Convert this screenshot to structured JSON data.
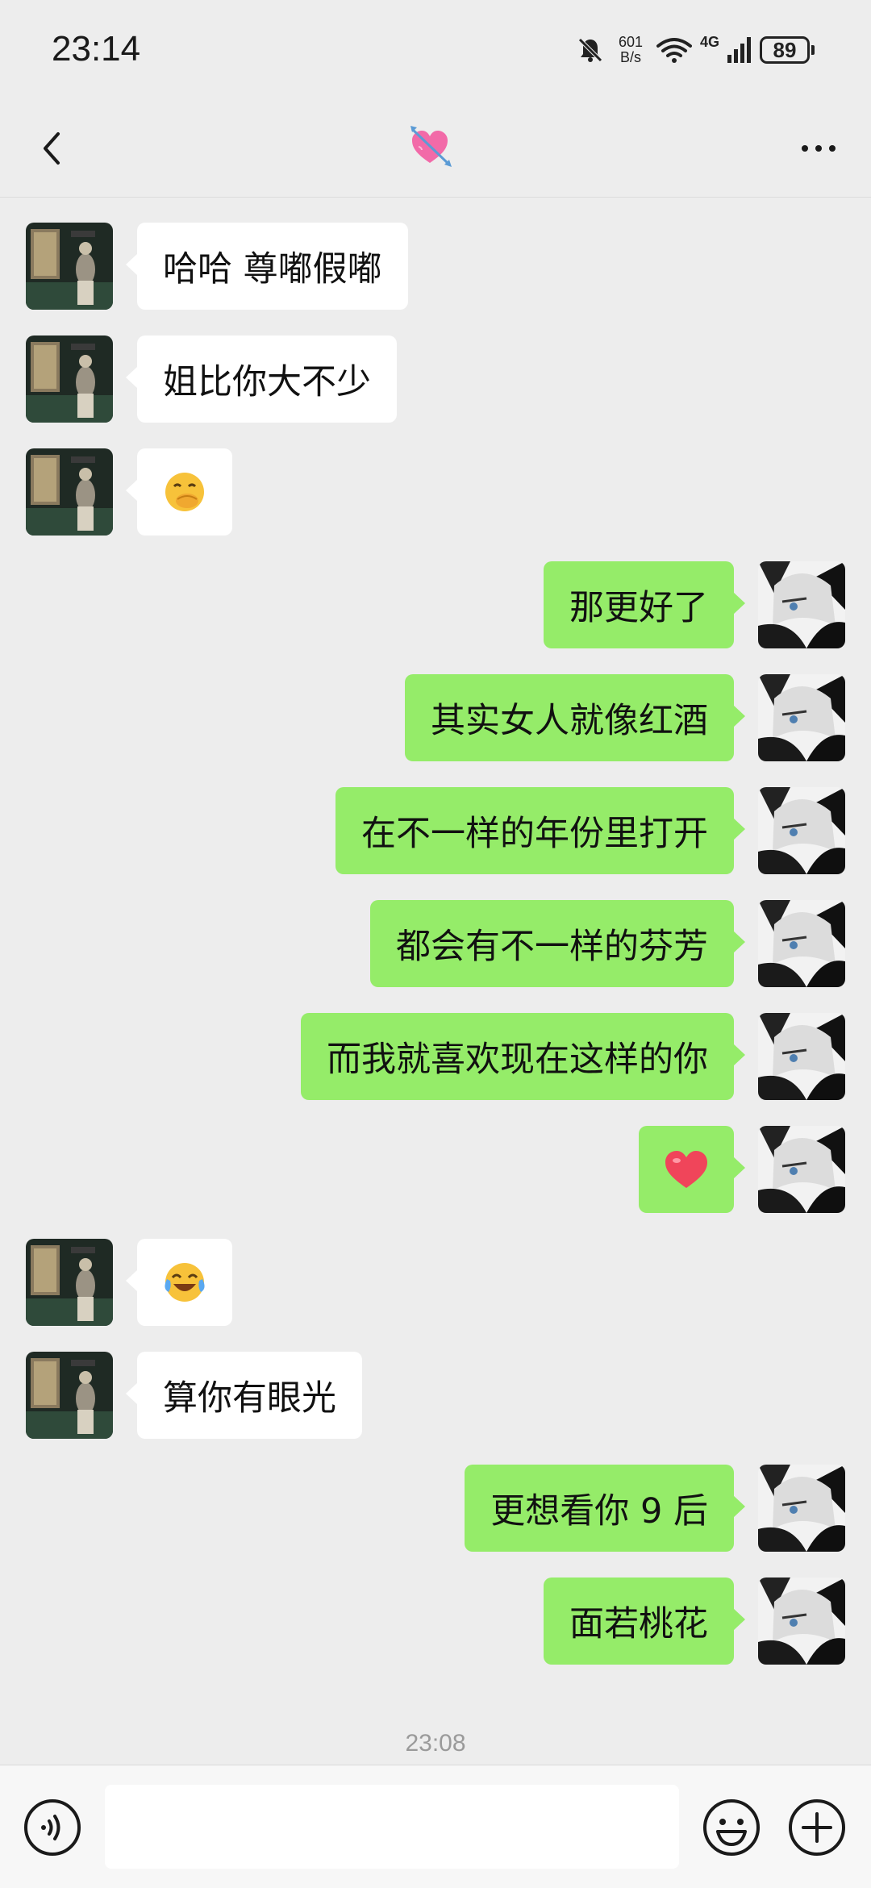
{
  "status": {
    "time": "23:14",
    "net_speed_value": "601",
    "net_speed_unit": "B/s",
    "network_type": "4G",
    "battery": "89"
  },
  "header": {
    "title_icon": "heart-with-arrow-icon",
    "back_icon": "chevron-left-icon",
    "more_icon": "more-dots-icon"
  },
  "messages": [
    {
      "side": "left",
      "text": "哈哈 尊嘟假嘟"
    },
    {
      "side": "left",
      "text": "姐比你大不少"
    },
    {
      "side": "left",
      "emoji": "🤭"
    },
    {
      "side": "right",
      "text": "那更好了"
    },
    {
      "side": "right",
      "text": "其实女人就像红酒"
    },
    {
      "side": "right",
      "text": "在不一样的年份里打开"
    },
    {
      "side": "right",
      "text": "都会有不一样的芬芳"
    },
    {
      "side": "right",
      "text": "而我就喜欢现在这样的你"
    },
    {
      "side": "right",
      "emoji": "❤️"
    },
    {
      "side": "left",
      "emoji": "😂"
    },
    {
      "side": "left",
      "text": "算你有眼光"
    },
    {
      "side": "right",
      "text": "更想看你 9 后"
    },
    {
      "side": "right",
      "text": "面若桃花"
    }
  ],
  "last_timestamp": "23:08",
  "input": {
    "placeholder": "",
    "value": "",
    "voice_icon": "voice-icon",
    "emoji_icon": "smiley-icon",
    "plus_icon": "plus-icon"
  },
  "colors": {
    "sent_bubble": "#95ec69",
    "received_bubble": "#ffffff",
    "background": "#ededed"
  }
}
